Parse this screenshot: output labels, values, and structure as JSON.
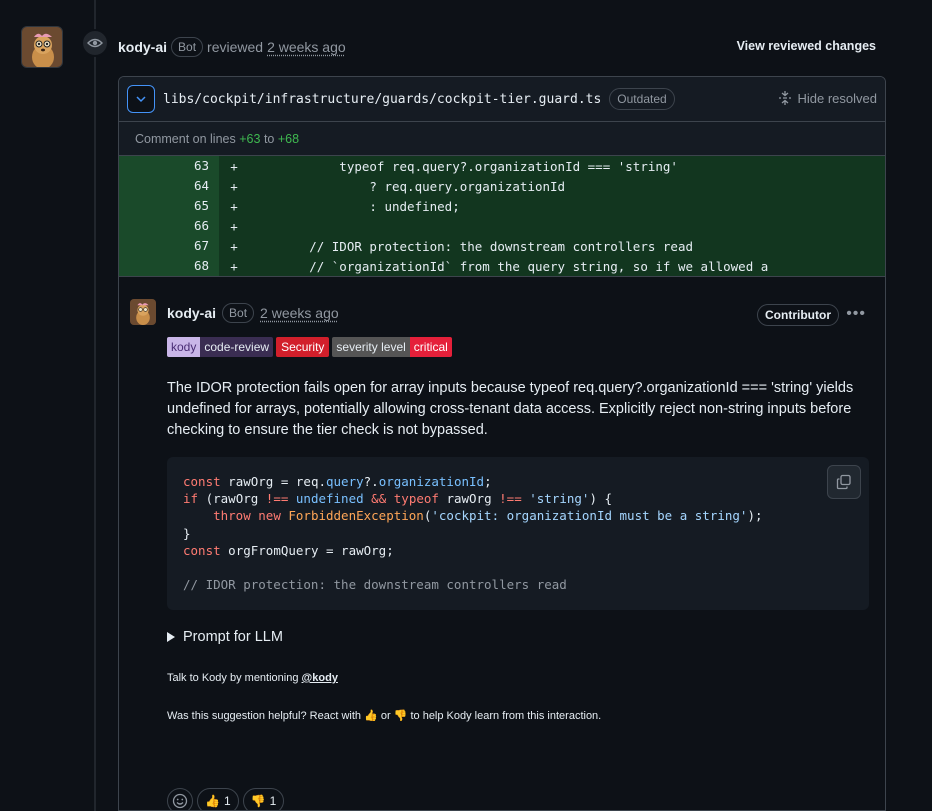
{
  "review": {
    "author": "kody-ai",
    "bot_label": "Bot",
    "action": "reviewed",
    "time": "2 weeks ago",
    "view_changes_label": "View reviewed changes"
  },
  "file": {
    "path": "libs/cockpit/infrastructure/guards/cockpit-tier.guard.ts",
    "outdated_label": "Outdated",
    "hide_resolved_label": "Hide resolved",
    "comment_lines_prefix": "Comment on lines",
    "line_start": "+63",
    "line_to": "to",
    "line_end": "+68"
  },
  "diff_lines": [
    {
      "num": "63",
      "sign": "+",
      "code": "            typeof req.query?.organizationId === 'string'"
    },
    {
      "num": "64",
      "sign": "+",
      "code": "                ? req.query.organizationId"
    },
    {
      "num": "65",
      "sign": "+",
      "code": "                : undefined;"
    },
    {
      "num": "66",
      "sign": "+",
      "code": ""
    },
    {
      "num": "67",
      "sign": "+",
      "code": "        // IDOR protection: the downstream controllers read"
    },
    {
      "num": "68",
      "sign": "+",
      "code": "        // `organizationId` from the query string, so if we allowed a"
    }
  ],
  "comment": {
    "author": "kody-ai",
    "bot_label": "Bot",
    "time": "2 weeks ago",
    "role": "Contributor",
    "labels": {
      "kody_left": "kody",
      "kody_right": "code-review",
      "security": "Security",
      "severity_left": "severity level",
      "severity_right": "critical"
    },
    "body": "The IDOR protection fails open for array inputs because typeof req.query?.organizationId === 'string' yields undefined for arrays, potentially allowing cross-tenant data access. Explicitly reject non-string inputs before checking to ensure the tier check is not bypassed.",
    "code": {
      "l1_a": "const",
      "l1_b": " rawOrg = req.",
      "l1_c": "query",
      "l1_d": "?.",
      "l1_e": "organizationId",
      "l1_f": ";",
      "l2_a": "if",
      "l2_b": " (rawOrg ",
      "l2_c": "!==",
      "l2_d": " ",
      "l2_e": "undefined",
      "l2_f": " ",
      "l2_g": "&&",
      "l2_h": " ",
      "l2_i": "typeof",
      "l2_j": " rawOrg ",
      "l2_k": "!==",
      "l2_l": " ",
      "l2_m": "'string'",
      "l2_n": ") {",
      "l3_a": "    throw",
      "l3_b": " ",
      "l3_c": "new",
      "l3_d": " ",
      "l3_e": "ForbiddenException",
      "l3_f": "(",
      "l3_g": "'cockpit: organizationId must be a string'",
      "l3_h": ");",
      "l4": "}",
      "l5_a": "const",
      "l5_b": " orgFromQuery = rawOrg;",
      "l7": "// IDOR protection: the downstream controllers read"
    },
    "prompt_llm": "Prompt for LLM",
    "talk_prefix": "Talk to Kody by mentioning",
    "talk_mention": "@kody",
    "helpful_a": "Was this suggestion helpful? React with",
    "helpful_b": "or",
    "helpful_c": "to help Kody learn from this interaction."
  },
  "reactions": {
    "thumbs_up_count": "1",
    "thumbs_down_count": "1"
  }
}
